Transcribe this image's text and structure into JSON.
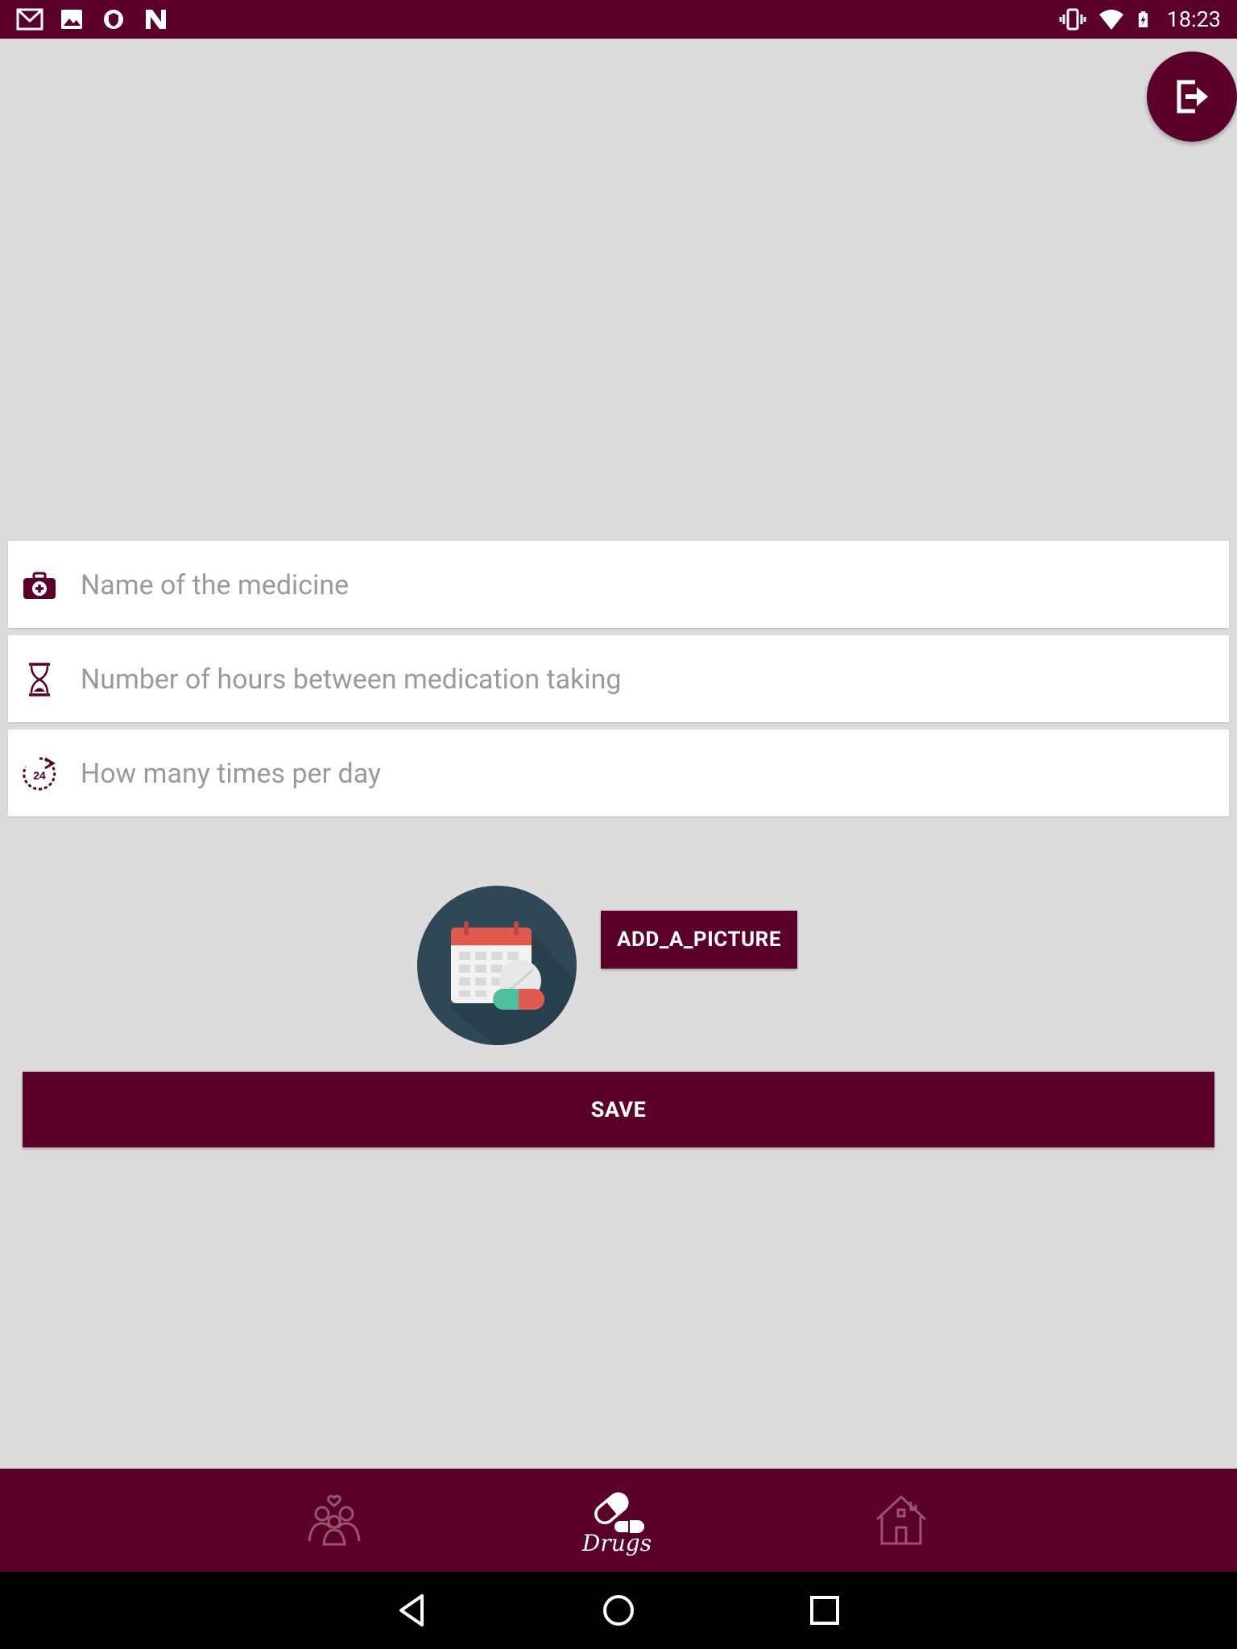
{
  "status_bar": {
    "time": "18:23",
    "left_icons": [
      "gmail-icon",
      "image-icon",
      "shield-icon",
      "n-icon"
    ],
    "right_icons": [
      "vibrate-icon",
      "wifi-icon",
      "battery-charging-icon"
    ]
  },
  "fab": {
    "icon": "logout-icon"
  },
  "form": {
    "medicine_name": {
      "placeholder": "Name of the medicine",
      "value": "",
      "icon": "medical-kit-icon"
    },
    "hours_between": {
      "placeholder": "Number of hours between medication taking",
      "value": "",
      "icon": "hourglass-icon"
    },
    "times_per_day": {
      "placeholder": "How many times per day",
      "value": "",
      "icon": "clock-24-icon"
    }
  },
  "picture": {
    "icon": "calendar-pill-icon"
  },
  "add_picture_label": "ADD_A_PICTURE",
  "save_label": "SAVE",
  "bottom_nav": {
    "items": [
      {
        "icon": "family-icon",
        "label": ""
      },
      {
        "icon": "pill-icon",
        "label": "Drugs",
        "active": true
      },
      {
        "icon": "house-icon",
        "label": ""
      }
    ]
  },
  "colors": {
    "primary": "#5a0029",
    "background": "#dcdcdc",
    "field_background": "#ffffff",
    "picture_circle": "#2f4858",
    "inactive_nav_icon": "#9a5470"
  }
}
